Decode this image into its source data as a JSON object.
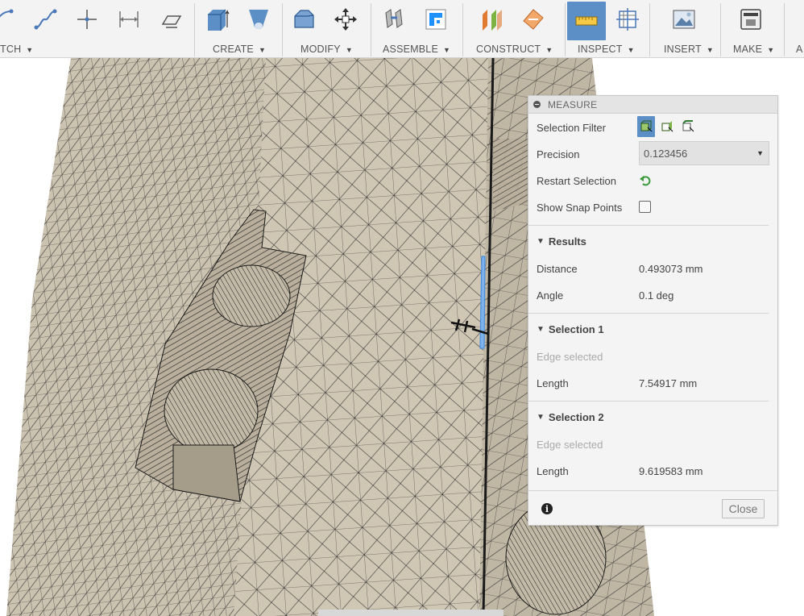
{
  "toolbar": {
    "groups": [
      {
        "label": "TCH"
      },
      {
        "label": "CREATE"
      },
      {
        "label": "MODIFY"
      },
      {
        "label": "ASSEMBLE"
      },
      {
        "label": "CONSTRUCT"
      },
      {
        "label": "INSPECT"
      },
      {
        "label": "INSERT"
      },
      {
        "label": "MAKE"
      },
      {
        "label": "A"
      }
    ],
    "active_group": "INSPECT",
    "accent_color": "#5b8fc6"
  },
  "measure": {
    "title": "MEASURE",
    "selection_filter_label": "Selection Filter",
    "precision_label": "Precision",
    "precision_value": "0.123456",
    "restart_label": "Restart Selection",
    "snap_points_label": "Show Snap Points",
    "snap_points_checked": false,
    "results": {
      "heading": "Results",
      "distance_label": "Distance",
      "distance_value": "0.493073 mm",
      "angle_label": "Angle",
      "angle_value": "0.1 deg"
    },
    "selection1": {
      "heading": "Selection 1",
      "status": "Edge selected",
      "length_label": "Length",
      "length_value": "7.54917 mm"
    },
    "selection2": {
      "heading": "Selection 2",
      "status": "Edge selected",
      "length_label": "Length",
      "length_value": "9.619583 mm"
    },
    "close_label": "Close",
    "info_glyph": "i"
  },
  "icons": {
    "collapse": "minus-circle-icon",
    "restart": "undo-arrow-icon",
    "info": "info-icon"
  },
  "colors": {
    "model_surface": "#c9c0ae",
    "mesh_line": "#2a2a2a",
    "selected_edge": "#4a90e2"
  }
}
